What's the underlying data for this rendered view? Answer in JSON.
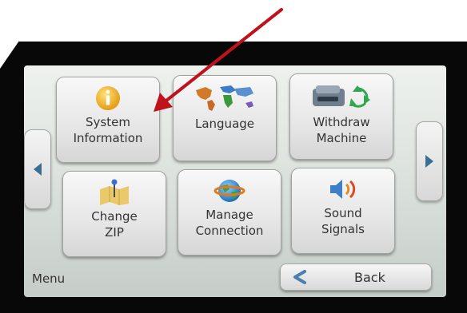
{
  "tiles": [
    {
      "label": "System\nInformation",
      "icon": "info-icon"
    },
    {
      "label": "Language",
      "icon": "world-map-icon"
    },
    {
      "label": "Withdraw\nMachine",
      "icon": "postage-recycle-icon"
    },
    {
      "label": "Change\nZIP",
      "icon": "map-pin-icon"
    },
    {
      "label": "Manage\nConnection",
      "icon": "globe-icon"
    },
    {
      "label": "Sound\nSignals",
      "icon": "speaker-icon"
    }
  ],
  "footer": {
    "menu_label": "Menu",
    "back_label": "Back"
  },
  "colors": {
    "annotation_arrow": "#c0121b",
    "nav_arrow": "#3a6f93",
    "back_chevron": "#4a7fb0",
    "info_icon": "#f2b82c"
  }
}
